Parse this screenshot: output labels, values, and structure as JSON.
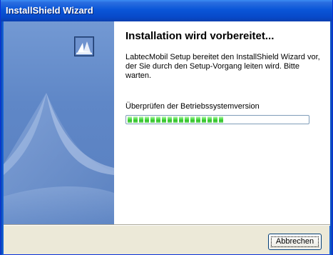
{
  "window": {
    "title": "InstallShield Wizard"
  },
  "main": {
    "heading": "Installation wird vorbereitet...",
    "description": "LabtecMobil Setup bereitet den InstallShield Wizard vor, der Sie durch den Setup-Vorgang leiten wird. Bitte warten.",
    "status_text": "Überprüfen der Betriebssystemversion",
    "progress": {
      "segments_filled": 17,
      "fraction": 0.53
    },
    "logo_icon": "installshield-logo-icon"
  },
  "footer": {
    "cancel_label": "Abbrechen"
  },
  "colors": {
    "titlebar": "#0a56d8",
    "side_panel": "#6089c8",
    "progress_fill": "#2ec026",
    "dialog_bg": "#ece9d8"
  }
}
